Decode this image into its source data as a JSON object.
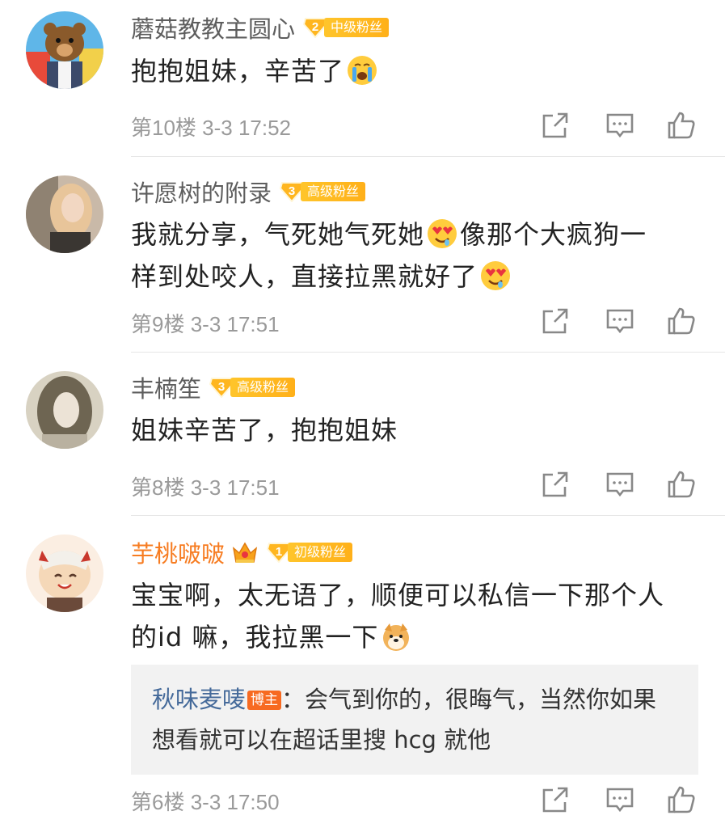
{
  "comments": [
    {
      "username": "蘑菇教教主圆心",
      "fan_level": "2",
      "fan_badge": "中级粉丝",
      "text_lines": [
        "抱抱姐妹，辛苦了"
      ],
      "floor": "第10楼",
      "time": "3-3 17:52"
    },
    {
      "username": "许愿树的附录",
      "fan_level": "3",
      "fan_badge": "高级粉丝",
      "text_lines": [
        "我就分享，气死她气死她",
        "像那个大疯狗一",
        "样到处咬人，直接拉黑就好了"
      ],
      "floor": "第9楼",
      "time": "3-3 17:51"
    },
    {
      "username": "丰楠笙",
      "fan_level": "3",
      "fan_badge": "高级粉丝",
      "text_lines": [
        "姐妹辛苦了，抱抱姐妹"
      ],
      "floor": "第8楼",
      "time": "3-3 17:51"
    },
    {
      "username": "芋桃啵啵",
      "fan_level": "1",
      "fan_badge": "初级粉丝",
      "text_lines": [
        "宝宝啊，太无语了，顺便可以私信一下那个人",
        "的id 嘛，我拉黑一下"
      ],
      "reply": {
        "author": "秋味麦唛",
        "host_badge": "博主",
        "separator": "：",
        "text": "会气到你的，很晦气，当然你如果想看就可以在超话里搜 hcg 就他"
      },
      "floor": "第6楼",
      "time": "3-3 17:50"
    }
  ],
  "icons": [
    "share-icon",
    "comment-icon",
    "like-icon",
    "crying-emoji",
    "heart-eyes-emoji",
    "dog-emoji",
    "crown-icon"
  ],
  "colors": {
    "username": "#5d5d5d",
    "vip_username": "#f77c21",
    "fan_badge": "#ffb61f",
    "reply_author": "#456a9a",
    "host_badge": "#f76a21"
  }
}
